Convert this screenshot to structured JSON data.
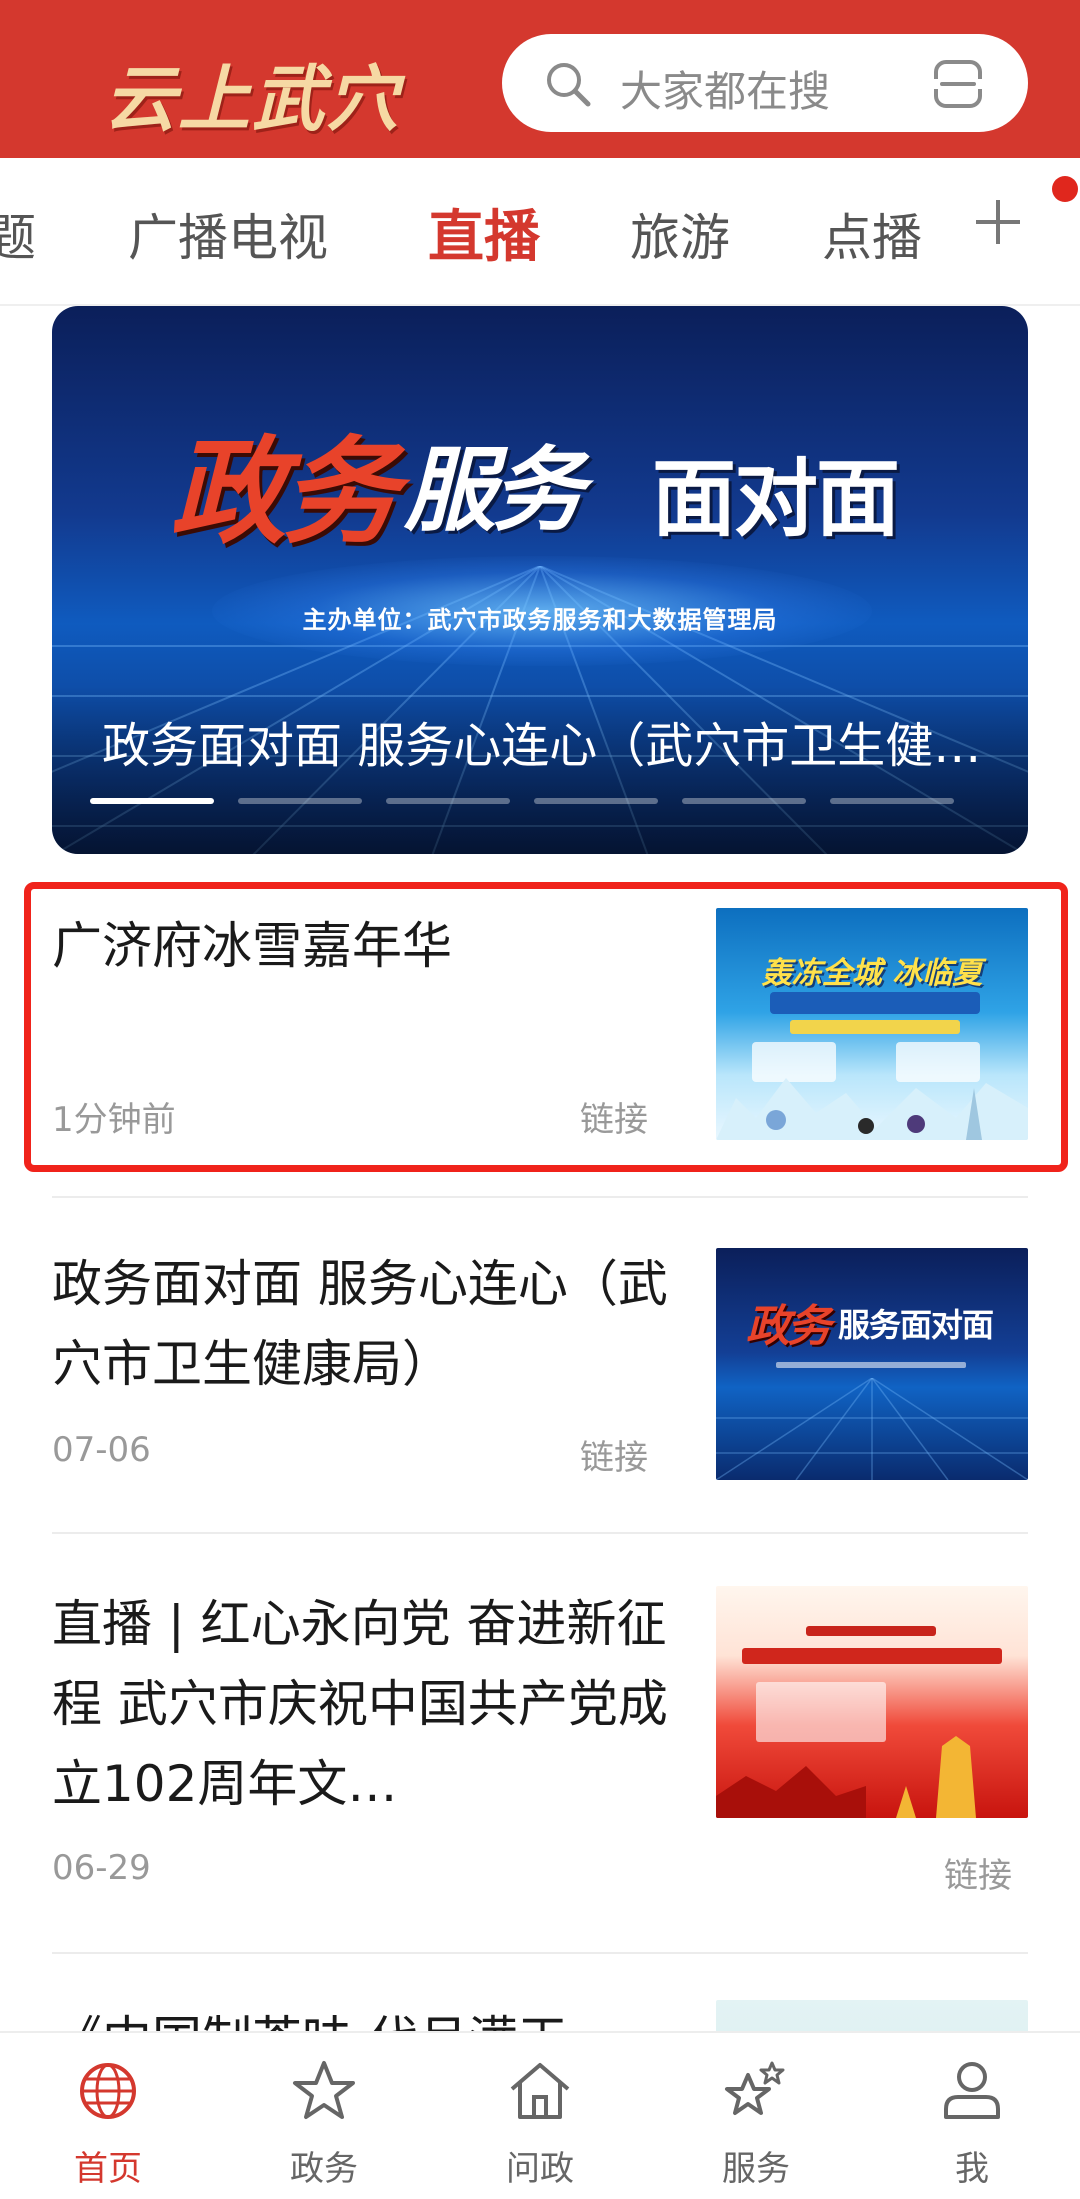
{
  "header": {
    "logo_text": "云上武穴",
    "search_placeholder": "大家都在搜",
    "bg_color": "#d4382e"
  },
  "tabs": {
    "items": [
      "题",
      "广播电视",
      "直播",
      "旅游",
      "点播"
    ],
    "active": "直播",
    "add_icon": "plus-icon",
    "has_notification": true
  },
  "banner": {
    "title_red": "政务",
    "title_white": "服务",
    "title_white2": "面对面",
    "host_line": "主办单位：武穴市政务服务和大数据管理局",
    "caption": "政务面对面 服务心连心（武穴市卫生健康局）",
    "slide_count": 6,
    "active_slide": 1
  },
  "news": [
    {
      "title": "广济府冰雪嘉年华",
      "time": "1分钟前",
      "type_label": "链接",
      "thumb_headline": "轰冻全城 冰临夏"
    },
    {
      "title": "政务面对面 服务心连心（武穴市卫生健康局）",
      "time": "07-06",
      "type_label": "链接",
      "thumb_t1": "政务",
      "thumb_t2": "服务面对面"
    },
    {
      "title": "直播 | 红心永向党 奋进新征程 武穴市庆祝中国共产党成立102周年文…",
      "time": "06-29",
      "type_label": "链接"
    },
    {
      "title": "《中国制茶味 代月满天"
    }
  ],
  "bottom_nav": [
    {
      "label": "首页",
      "icon": "globe-icon",
      "active": true
    },
    {
      "label": "政务",
      "icon": "star-icon",
      "active": false
    },
    {
      "label": "问政",
      "icon": "home-icon",
      "active": false
    },
    {
      "label": "服务",
      "icon": "stars-icon",
      "active": false
    },
    {
      "label": "我",
      "icon": "user-icon",
      "active": false
    }
  ],
  "colors": {
    "accent": "#d4382e",
    "highlight_border": "#f0231b"
  }
}
